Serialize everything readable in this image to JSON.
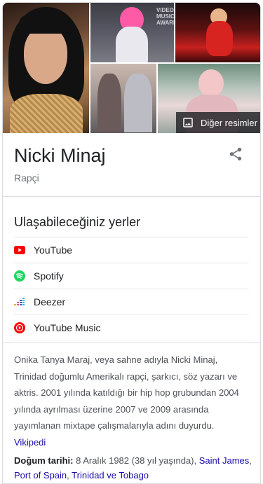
{
  "images": {
    "more_label": "Diğer resimler",
    "sign_text": "VIDEO MUSIC AWARDS"
  },
  "entity": {
    "name": "Nicki Minaj",
    "type": "Rapçi"
  },
  "profiles": {
    "heading": "Ulaşabileceğiniz yerler",
    "items": [
      {
        "label": "YouTube",
        "icon": "youtube-icon",
        "color": "#ff0000"
      },
      {
        "label": "Spotify",
        "icon": "spotify-icon",
        "color": "#1ed760"
      },
      {
        "label": "Deezer",
        "icon": "deezer-icon",
        "color": "#ef5466"
      },
      {
        "label": "YouTube Music",
        "icon": "youtube-music-icon",
        "color": "#ff0000"
      }
    ]
  },
  "description": {
    "text": "Onika Tanya Maraj, veya sahne adıyla Nicki Minaj, Trinidad doğumlu Amerikalı rapçi, şarkıcı, söz yazarı ve aktris. 2001 yılında katıldığı bir hip hop grubundan 2004 yılında ayrılması üzerine 2007 ve 2009 arasında yayımlanan mixtape çalışmalarıyla adını duyurdu.",
    "source": "Vikipedi"
  },
  "birth": {
    "label": "Doğum tarihi:",
    "value": "8 Aralık 1982 (38 yıl yaşında),",
    "place1": "Saint James",
    "sep1": ",",
    "place2": "Port of Spain",
    "sep2": ",",
    "place3": "Trinidad ve Tobago"
  },
  "colors": {
    "link": "#1a0dab",
    "text": "#202124",
    "muted": "#70757a"
  }
}
